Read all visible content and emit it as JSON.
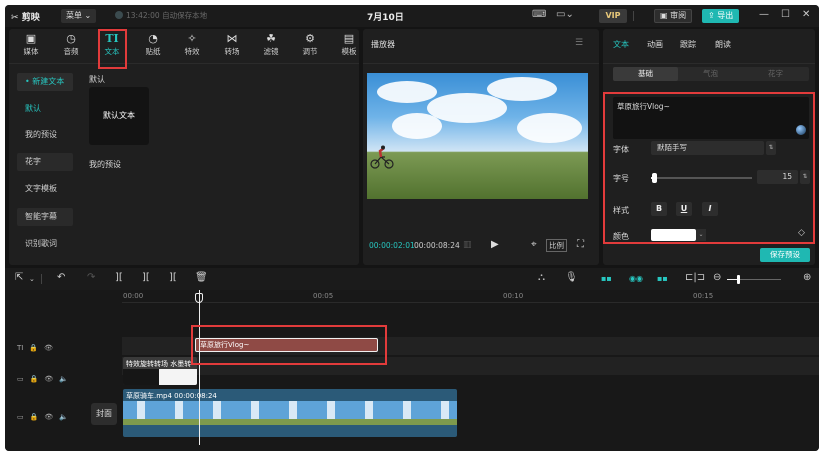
{
  "titlebar": {
    "app_name": "剪映",
    "menu_label": "菜单",
    "save_status": "13:42:00 自动保存本地",
    "date": "7月10日",
    "vip_label": "VIP",
    "review_label": "审阅",
    "export_label": "导出"
  },
  "tools": [
    {
      "label": "媒体",
      "icon": "▣"
    },
    {
      "label": "音频",
      "icon": "◷"
    },
    {
      "label": "文本",
      "icon": "TI"
    },
    {
      "label": "贴纸",
      "icon": "◔"
    },
    {
      "label": "特效",
      "icon": "✧"
    },
    {
      "label": "转场",
      "icon": "⋈"
    },
    {
      "label": "滤镜",
      "icon": "☘"
    },
    {
      "label": "调节",
      "icon": "⚙"
    },
    {
      "label": "模板",
      "icon": "▤"
    }
  ],
  "sidebar": {
    "items": [
      "• 新建文本",
      "默认",
      "我的预设",
      "花字",
      "文字模板",
      "智能字幕",
      "识别歌词"
    ]
  },
  "library": {
    "section_default": "默认",
    "card_default": "默认文本",
    "section_presets": "我的预设"
  },
  "player": {
    "title": "播放器",
    "time_current": "00:00:02:01",
    "time_total": "00:00:08:24",
    "ratio_label": "比例"
  },
  "inspector": {
    "tabs": [
      "文本",
      "动画",
      "跟踪",
      "朗读"
    ],
    "subtabs": [
      "基础",
      "气泡",
      "花字"
    ],
    "text_value": "草原旅行Vlog~",
    "font_label": "字体",
    "font_value": "默陌手写",
    "size_label": "字号",
    "size_value": "15",
    "style_label": "样式",
    "style_buttons": [
      "B",
      "U",
      "I"
    ],
    "color_label": "颜色",
    "color_value": "#ffffff",
    "save_preset": "保存预设"
  },
  "timeline": {
    "ruler": [
      "00:00",
      "00:05",
      "00:10",
      "00:15"
    ],
    "text_clip": "草原旅行Vlog~",
    "effect_clip": "特效旋转转场 水墨转",
    "video_clip": "草原骑车.mp4  00:00:08:24",
    "cover_label": "封面"
  },
  "colors": {
    "accent": "#27c6c0",
    "highlight": "#e23b3b",
    "text_clip": "#8f4a45"
  }
}
